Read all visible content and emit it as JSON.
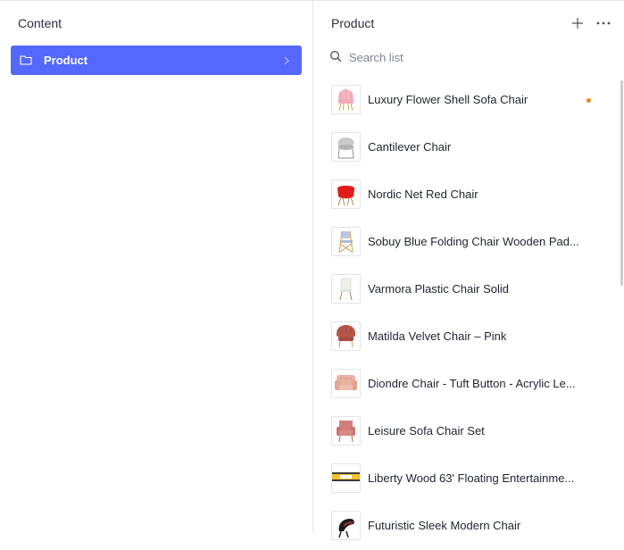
{
  "left": {
    "header": "Content",
    "items": [
      {
        "label": "Product",
        "icon": "folder-icon",
        "selected": true
      }
    ]
  },
  "right": {
    "header": "Product",
    "search_placeholder": "Search list",
    "items": [
      {
        "title": "Luxury Flower Shell Sofa Chair",
        "status_dot": true,
        "dot_color": "#e38b1d"
      },
      {
        "title": "Cantilever Chair"
      },
      {
        "title": "Nordic Net Red Chair"
      },
      {
        "title": "Sobuy Blue Folding Chair Wooden Pad..."
      },
      {
        "title": "Varmora Plastic Chair Solid"
      },
      {
        "title": "Matilda Velvet Chair – Pink"
      },
      {
        "title": "Diondre Chair - Tuft Button - Acrylic Le..."
      },
      {
        "title": "Leisure Sofa Chair Set"
      },
      {
        "title": "Liberty Wood 63' Floating Entertainme..."
      },
      {
        "title": "Futuristic Sleek Modern Chair"
      }
    ]
  },
  "colors": {
    "accent": "#5468ff",
    "status_dot": "#e38b1d",
    "divider": "#e3e5ea"
  }
}
